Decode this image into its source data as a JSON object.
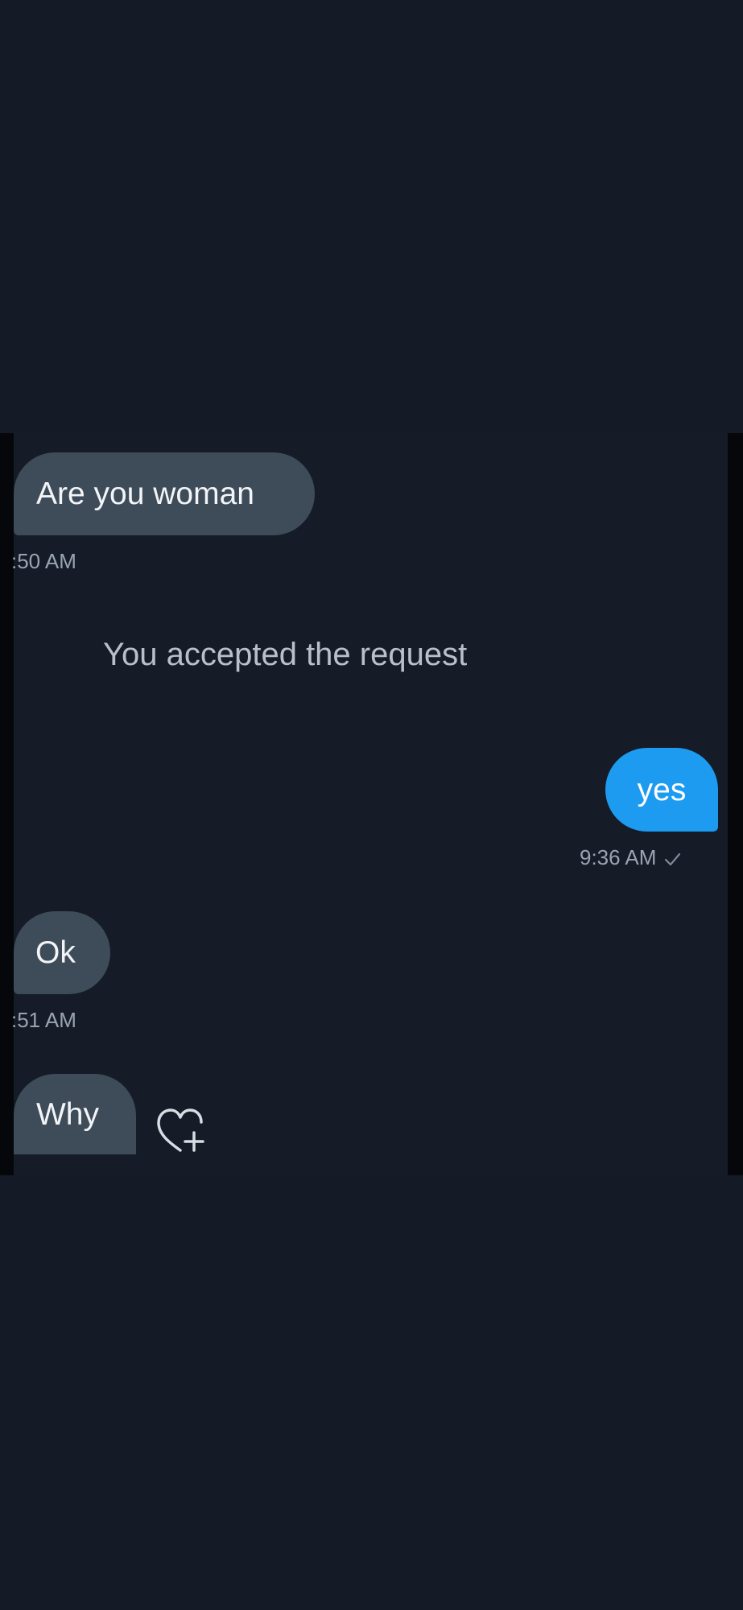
{
  "conversation": {
    "messages": [
      {
        "text": "Are you woman",
        "time": ":50 AM",
        "from": "other"
      },
      {
        "text": "yes",
        "time": "9:36 AM",
        "from": "me",
        "status_icon": "sent-check-icon"
      },
      {
        "text": "Ok",
        "time": ":51 AM",
        "from": "other"
      },
      {
        "text": "Why",
        "from": "other",
        "action_icon": "add-reaction-heart-icon"
      }
    ],
    "system_notice": "You accepted the request"
  },
  "colors": {
    "background": "#141a26",
    "received_bubble": "#3e4b59",
    "sent_bubble": "#1d9bf0",
    "timestamp": "#9aa4b1",
    "notice_text": "#b9c0c9"
  }
}
